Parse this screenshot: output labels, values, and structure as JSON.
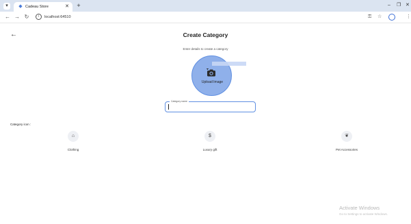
{
  "browser": {
    "tab_title": "Cadeau Store",
    "tab_close": "✕",
    "new_tab": "+",
    "url": "localhost:64510",
    "controls": {
      "minimize": "–",
      "maximize": "❐",
      "close": "✕"
    }
  },
  "page": {
    "back_icon": "←",
    "title": "Create Category",
    "subtitle": "Enter details to create a category",
    "upload_label": "Upload Image",
    "name_field_label": "Category name",
    "category_icon_heading": "Category icon :",
    "categories": [
      {
        "label": "Clothing",
        "icon": "hanger-icon",
        "glyph": "⌂"
      },
      {
        "label": "Luxury gift",
        "icon": "dollar-icon",
        "glyph": "$"
      },
      {
        "label": "Pet Accessories",
        "icon": "paw-icon",
        "glyph": "❦"
      }
    ]
  },
  "watermark": {
    "title": "Activate Windows",
    "subtitle": "Go to Settings to activate Windows."
  },
  "colors": {
    "accent": "#5f8fe2",
    "upload_fill": "#8fb0ea",
    "tabstrip": "#dbe4f1"
  }
}
